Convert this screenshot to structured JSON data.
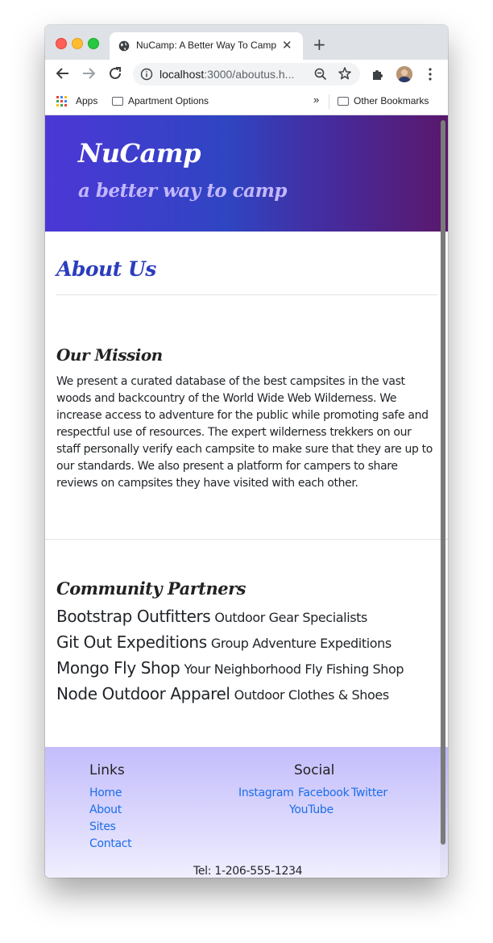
{
  "browser": {
    "tab_title": "NuCamp: A Better Way To Camp",
    "new_tab": "+",
    "url_host": "localhost",
    "url_rest": ":3000/aboutus.h...",
    "bookmarks": {
      "apps": "Apps",
      "apartment": "Apartment Options",
      "more": "»",
      "other": "Other Bookmarks"
    }
  },
  "header": {
    "brand": "NuCamp",
    "tagline": "a better way to camp"
  },
  "about": {
    "title": "About Us",
    "mission_title": "Our Mission",
    "mission_text": "We present a curated database of the best campsites in the vast woods and backcountry of the World Wide Web Wilderness. We increase access to adventure for the public while promoting safe and respectful use of resources. The expert wilderness trekkers on our staff personally verify each campsite to make sure that they are up to our standards. We also present a platform for campers to share reviews on campsites they have visited with each other.",
    "partners_title": "Community Partners",
    "partners": [
      {
        "name": "Bootstrap Outfitters",
        "desc": "Outdoor Gear Specialists"
      },
      {
        "name": "Git Out Expeditions",
        "desc": "Group Adventure Expeditions"
      },
      {
        "name": "Mongo Fly Shop",
        "desc": "Your Neighborhood Fly Fishing Shop"
      },
      {
        "name": "Node Outdoor Apparel",
        "desc": "Outdoor Clothes & Shoes"
      }
    ]
  },
  "footer": {
    "links_heading": "Links",
    "links": [
      "Home",
      "About",
      "Sites",
      "Contact"
    ],
    "social_heading": "Social",
    "social": [
      "Instagram",
      "Facebook",
      "Twitter",
      "YouTube"
    ],
    "tel": "Tel: 1-206-555-1234"
  },
  "colors": {
    "brand_blue": "#2b3dbd",
    "link": "#1b6ee9"
  }
}
